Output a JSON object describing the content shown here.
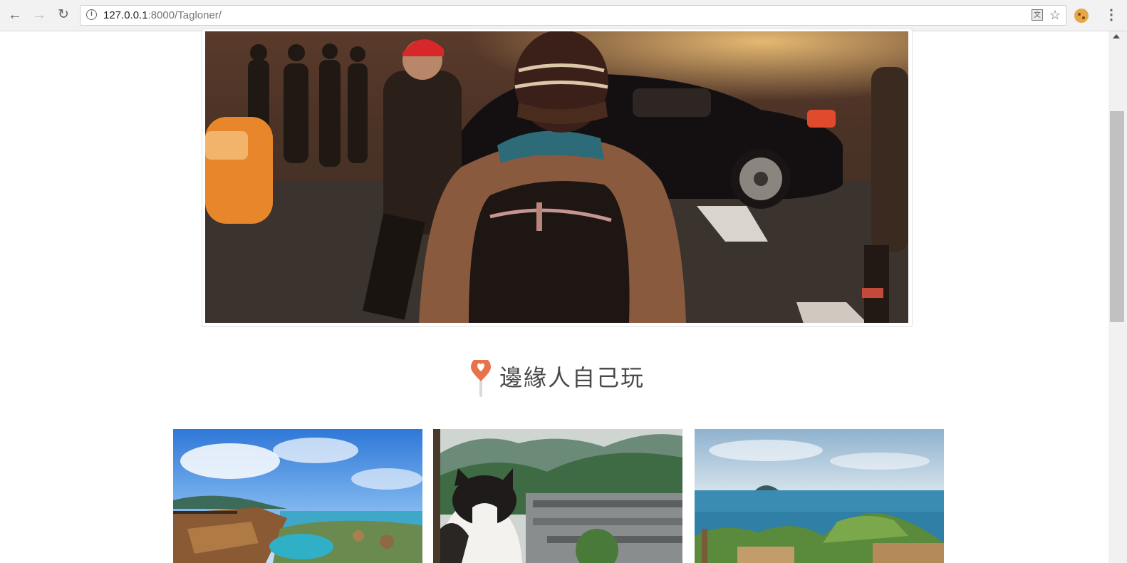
{
  "browser": {
    "url_host": "127.0.0.1",
    "url_rest": ":8000/Tagloner/",
    "icons": [
      "back-arrow-icon",
      "forward-arrow-icon",
      "reload-icon",
      "info-icon",
      "translate-icon",
      "star-icon",
      "cookie-icon",
      "menu-icon"
    ]
  },
  "hero": {
    "image": "street-backpacker-photo"
  },
  "section": {
    "title": "邊緣人自己玩",
    "icon": "map-pin-heart-icon",
    "accent_color": "#e8734a"
  },
  "cards": [
    {
      "image": "coastal-rock-formations-photo"
    },
    {
      "image": "cat-mountain-village-photo"
    },
    {
      "image": "sea-island-cliff-photo"
    }
  ]
}
